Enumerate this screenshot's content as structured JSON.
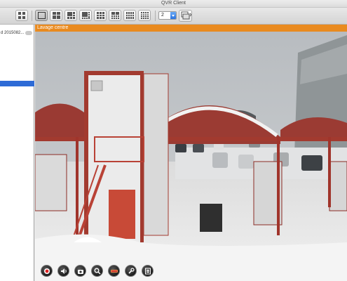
{
  "window": {
    "title": "QVR Client"
  },
  "toolbar": {
    "layout_buttons": [
      {
        "name": "layout-sidebar-button"
      },
      {
        "name": "layout-single-button"
      },
      {
        "name": "layout-4-button"
      },
      {
        "name": "layout-6-button"
      },
      {
        "name": "layout-8-button"
      },
      {
        "name": "layout-9-button"
      },
      {
        "name": "layout-10-button"
      },
      {
        "name": "layout-12-button"
      },
      {
        "name": "layout-16-button"
      }
    ],
    "page_select_value": "2"
  },
  "sidebar": {
    "items": [
      {
        "label": "d 2015082...",
        "badge": ""
      }
    ]
  },
  "camera": {
    "name": "Lavage centre",
    "header_color": "#e98a1f"
  },
  "controls": [
    {
      "icon": "record-icon"
    },
    {
      "icon": "audio-icon"
    },
    {
      "icon": "snapshot-icon"
    },
    {
      "icon": "zoom-icon"
    },
    {
      "icon": "ptz-icon"
    },
    {
      "icon": "settings-icon"
    },
    {
      "icon": "list-icon"
    }
  ]
}
